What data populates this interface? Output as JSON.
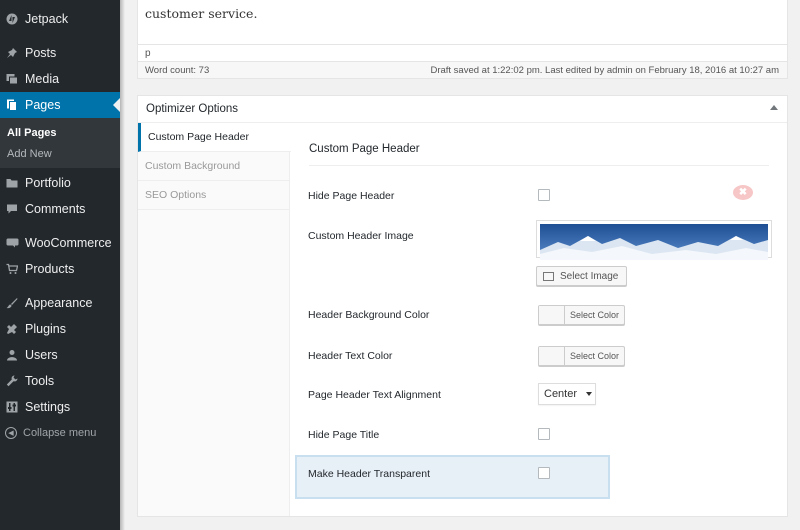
{
  "sidebar": {
    "items": [
      {
        "label": "Jetpack",
        "icon": "jetpack-icon"
      },
      {
        "label": "Posts",
        "icon": "pin-icon"
      },
      {
        "label": "Media",
        "icon": "media-icon"
      },
      {
        "label": "Pages",
        "icon": "pages-icon"
      },
      {
        "label": "Portfolio",
        "icon": "folder-icon"
      },
      {
        "label": "Comments",
        "icon": "comment-icon"
      },
      {
        "label": "WooCommerce",
        "icon": "woo-icon"
      },
      {
        "label": "Products",
        "icon": "cart-icon"
      },
      {
        "label": "Appearance",
        "icon": "brush-icon"
      },
      {
        "label": "Plugins",
        "icon": "plugin-icon"
      },
      {
        "label": "Users",
        "icon": "user-icon"
      },
      {
        "label": "Tools",
        "icon": "wrench-icon"
      },
      {
        "label": "Settings",
        "icon": "settings-icon"
      }
    ],
    "submenu": [
      "All Pages",
      "Add New"
    ],
    "collapse_label": "Collapse menu",
    "accent_color": "#0073aa"
  },
  "editor": {
    "text": "customer service.",
    "path": "p",
    "word_count": "Word count: 73",
    "draft_status": "Draft saved at 1:22:02 pm. Last edited by admin on February 18, 2016 at 10:27 am"
  },
  "optimizer": {
    "title": "Optimizer Options",
    "tabs": [
      "Custom Page Header",
      "Custom Background",
      "SEO Options"
    ],
    "panel_title": "Custom Page Header",
    "close_glyph": "✖",
    "rows": {
      "hide_header": "Hide Page Header",
      "header_image": "Custom Header Image",
      "bg_color": "Header Background Color",
      "text_color": "Header Text Color",
      "alignment": "Page Header Text Alignment",
      "hide_title": "Hide Page Title",
      "transparent": "Make Header Transparent"
    },
    "select_image_label": "Select Image",
    "select_color_label": "Select Color",
    "alignment_value": "Center"
  }
}
